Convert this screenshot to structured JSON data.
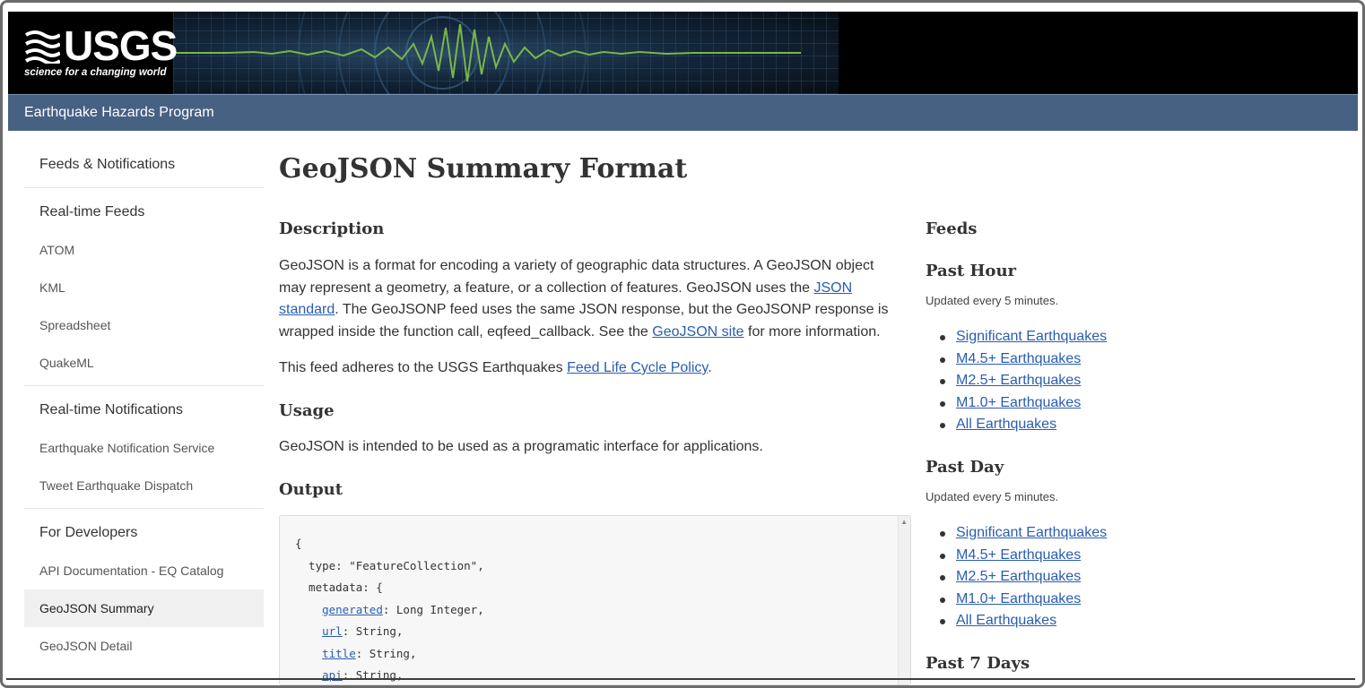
{
  "header": {
    "logo_text": "USGS",
    "tagline": "science for a changing world",
    "program": "Earthquake Hazards Program"
  },
  "sidebar": {
    "sections": [
      {
        "heading": "Feeds & Notifications",
        "items": []
      },
      {
        "heading": "Real-time Feeds",
        "items": [
          "ATOM",
          "KML",
          "Spreadsheet",
          "QuakeML"
        ]
      },
      {
        "heading": "Real-time Notifications",
        "items": [
          "Earthquake Notification Service",
          "Tweet Earthquake Dispatch"
        ]
      },
      {
        "heading": "For Developers",
        "items": [
          "API Documentation - EQ Catalog",
          "GeoJSON Summary",
          "GeoJSON Detail"
        ]
      }
    ],
    "active_item": "GeoJSON Summary"
  },
  "main": {
    "title": "GeoJSON Summary Format",
    "description_heading": "Description",
    "description_p1_a": "GeoJSON is a format for encoding a variety of geographic data structures. A GeoJSON object may represent a geometry, a feature, or a collection of features. GeoJSON uses the ",
    "description_p1_link1": "JSON standard",
    "description_p1_b": ". The GeoJSONP feed uses the same JSON response, but the GeoJSONP response is wrapped inside the function call, eqfeed_callback. See the ",
    "description_p1_link2": "GeoJSON site",
    "description_p1_c": " for more information.",
    "description_p2_a": "This feed adheres to the USGS Earthquakes ",
    "description_p2_link": "Feed Life Cycle Policy",
    "description_p2_b": ".",
    "usage_heading": "Usage",
    "usage_text": "GeoJSON is intended to be used as a programatic interface for applications.",
    "output_heading": "Output",
    "code": {
      "line1": "{",
      "line2": "  type: \"FeatureCollection\",",
      "line3": "  metadata: {",
      "line4_key": "generated",
      "line4_rest": ": Long Integer,",
      "line5_key": "url",
      "line5_rest": ": String,",
      "line6_key": "title",
      "line6_rest": ": String,",
      "line7_key": "api",
      "line7_rest": ": String,"
    }
  },
  "aside": {
    "feeds_heading": "Feeds",
    "groups": [
      {
        "heading": "Past Hour",
        "note": "Updated every 5 minutes.",
        "links": [
          "Significant Earthquakes",
          "M4.5+ Earthquakes",
          "M2.5+ Earthquakes",
          "M1.0+ Earthquakes",
          "All Earthquakes"
        ]
      },
      {
        "heading": "Past Day",
        "note": "Updated every 5 minutes.",
        "links": [
          "Significant Earthquakes",
          "M4.5+ Earthquakes",
          "M2.5+ Earthquakes",
          "M1.0+ Earthquakes",
          "All Earthquakes"
        ]
      },
      {
        "heading": "Past 7 Days"
      }
    ]
  },
  "colors": {
    "program_bar": "#476183",
    "link": "#2a5db0",
    "banner": "#000000",
    "seismograph": "#7ab648"
  }
}
